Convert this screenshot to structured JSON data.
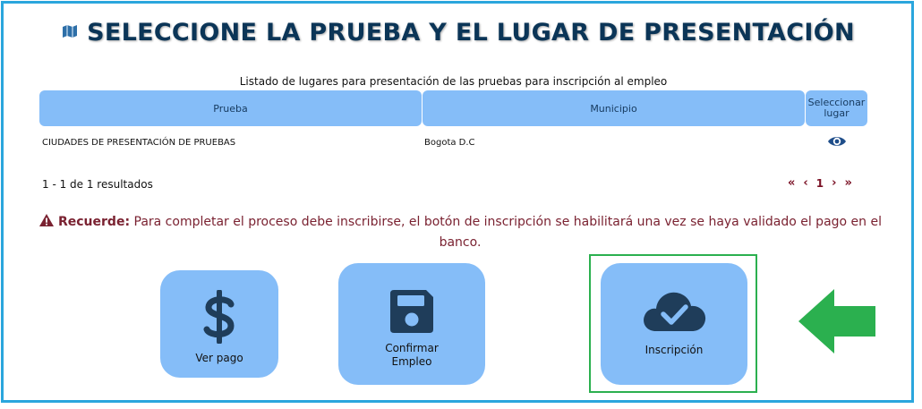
{
  "page": {
    "title": "SELECCIONE LA PRUEBA Y EL LUGAR DE PRESENTACIÓN",
    "title_icon": "map-icon"
  },
  "table": {
    "caption": "Listado de lugares para presentación de las pruebas para inscripción al empleo",
    "headers": [
      "Prueba",
      "Municipio",
      "Seleccionar lugar"
    ],
    "rows": [
      {
        "prueba": "CIUDADES DE PRESENTACIÓN DE PRUEBAS",
        "municipio": "Bogota D.C",
        "action_icon": "eye-icon"
      }
    ]
  },
  "pagination": {
    "summary": "1 - 1 de 1 resultados",
    "first": "«",
    "prev": "‹",
    "current": "1",
    "next": "›",
    "last": "»"
  },
  "notice": {
    "icon": "warning-icon",
    "label": "Recuerde:",
    "text": "Para completar el proceso debe inscribirse, el botón de inscripción se habilitará una vez se haya validado el pago en el banco."
  },
  "actions": {
    "ver_pago": {
      "label": "Ver pago",
      "icon": "dollar-icon"
    },
    "confirmar": {
      "label_line1": "Confirmar",
      "label_line2": "Empleo",
      "icon": "floppy-disk-icon"
    },
    "inscripcion": {
      "label": "Inscripción",
      "icon": "cloud-check-icon"
    }
  },
  "colors": {
    "frame": "#2aa6dd",
    "header_bg": "#85bdf8",
    "title": "#0b3557",
    "accent_red": "#7a1024",
    "highlight": "#2bb04f",
    "arrow": "#2bb04f",
    "icon_dark": "#1f3d5a"
  }
}
